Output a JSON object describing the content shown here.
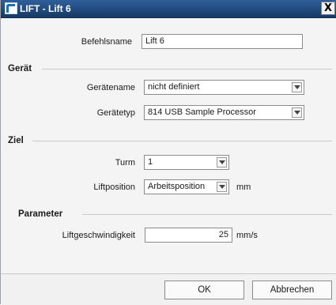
{
  "window": {
    "title": "LIFT - Lift 6",
    "close_glyph": "X",
    "icon": "app-logo-icon"
  },
  "command": {
    "label": "Befehlsname",
    "value": "Lift 6"
  },
  "sections": {
    "device": "Gerät",
    "target": "Ziel",
    "parameters": "Parameter"
  },
  "device": {
    "name_label": "Gerätename",
    "name_value": "nicht definiert",
    "type_label": "Gerätetyp",
    "type_value": "814 USB Sample Processor"
  },
  "target": {
    "tower_label": "Turm",
    "tower_value": "1",
    "position_label": "Liftposition",
    "position_value": "Arbeitsposition",
    "position_unit": "mm"
  },
  "parameters": {
    "speed_label": "Liftgeschwindigkeit",
    "speed_value": "25",
    "speed_unit": "mm/s"
  },
  "buttons": {
    "ok": "OK",
    "cancel": "Abbrechen"
  }
}
